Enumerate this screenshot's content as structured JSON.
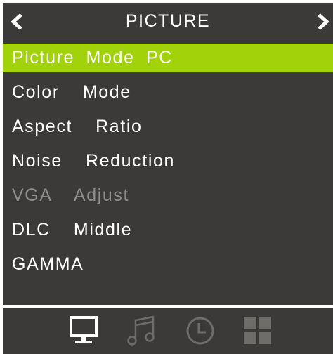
{
  "header": {
    "title": "PICTURE",
    "prev_icon": "chevron-left-icon",
    "next_icon": "chevron-right-icon"
  },
  "menu": {
    "items": [
      {
        "label": "Picture Mode PC",
        "state": "selected"
      },
      {
        "label": "Color  Mode",
        "state": "normal"
      },
      {
        "label": "Aspect  Ratio",
        "state": "normal"
      },
      {
        "label": "Noise  Reduction",
        "state": "normal"
      },
      {
        "label": "VGA  Adjust",
        "state": "disabled"
      },
      {
        "label": "DLC  Middle",
        "state": "normal"
      },
      {
        "label": "GAMMA",
        "state": "normal"
      }
    ]
  },
  "tabs": [
    {
      "icon": "monitor-icon",
      "active": true
    },
    {
      "icon": "music-note-icon",
      "active": false
    },
    {
      "icon": "clock-icon",
      "active": false
    },
    {
      "icon": "grid-icon",
      "active": false
    }
  ],
  "colors": {
    "panel_background": "#3b3a38",
    "highlight": "#a2d20a",
    "text": "#ffffff",
    "disabled_text": "#8f8f8d",
    "inactive_icon": "#6e6d6a"
  }
}
